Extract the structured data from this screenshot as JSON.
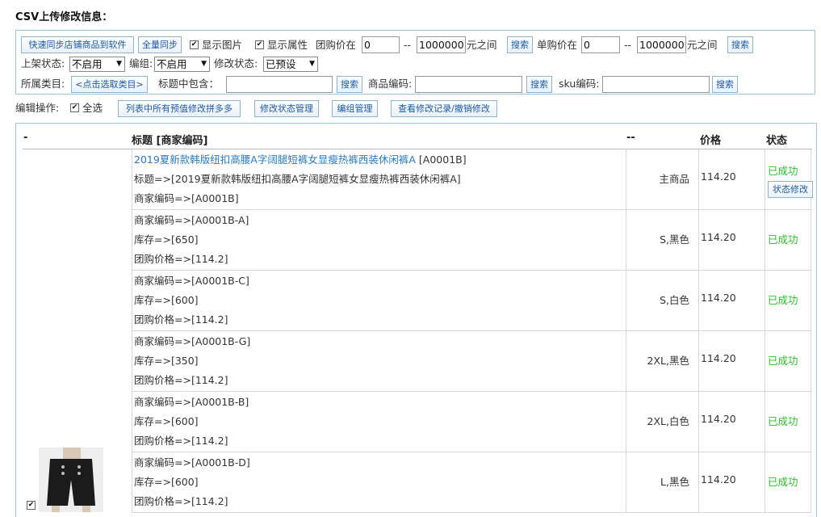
{
  "page": {
    "title": "CSV上传修改信息："
  },
  "filters": {
    "sync_button": "快速同步店铺商品到软件",
    "full_sync_button": "全量同步",
    "show_image_label": "显示图片",
    "show_attr_label": "显示属性",
    "group_price_label": "团购价在",
    "group_price_min": "0",
    "group_price_sep": "--",
    "group_price_max": "1000000",
    "group_price_unit": "元之间",
    "search_label": "搜索",
    "unit_price_label": "单购价在",
    "unit_price_min": "0",
    "unit_price_sep": "--",
    "unit_price_max": "1000000",
    "unit_price_unit": "元之间",
    "listing_status_label": "上架状态:",
    "listing_status_value": "不启用",
    "group_label": "编组:",
    "group_value": "不启用",
    "modify_status_label": "修改状态:",
    "modify_status_value": "已预设",
    "category_label": "所属类目:",
    "category_button": "<点击选取类目>",
    "title_contains_label": "标题中包含：",
    "product_code_label": "商品编码:",
    "sku_code_label": "sku编码:"
  },
  "edit_bar": {
    "label": "编辑操作:",
    "select_all": "全选",
    "apply_preset_button": "列表中所有预值修改拼多多",
    "status_manage_button": "修改状态管理",
    "group_manage_button": "编组管理",
    "history_button": "查看修改记录/撤销修改"
  },
  "table": {
    "headers": {
      "col0": "-",
      "title": "标题 [商家编码]",
      "spec": "--",
      "price": "价格",
      "status": "状态"
    },
    "main": {
      "title_link": "2019夏新款韩版纽扣高腰A字阔腿短裤女显瘦热裤西装休闲裤A",
      "code": "[A0001B]",
      "title_line": "标题=>[2019夏新款韩版纽扣高腰A字阔腿短裤女显瘦热裤西装休闲裤A]",
      "code_line": "商家编码=>[A0001B]",
      "spec": "主商品",
      "price": "114.20",
      "status": "已成功",
      "status_button": "状态修改"
    },
    "rows": [
      {
        "code_line": "商家编码=>[A0001B-A]",
        "stock_line": "库存=>[650]",
        "price_line": "团购价格=>[114.2]",
        "spec": "S,黑色",
        "price": "114.20",
        "status": "已成功"
      },
      {
        "code_line": "商家编码=>[A0001B-C]",
        "stock_line": "库存=>[600]",
        "price_line": "团购价格=>[114.2]",
        "spec": "S,白色",
        "price": "114.20",
        "status": "已成功"
      },
      {
        "code_line": "商家编码=>[A0001B-G]",
        "stock_line": "库存=>[350]",
        "price_line": "团购价格=>[114.2]",
        "spec": "2XL,黑色",
        "price": "114.20",
        "status": "已成功"
      },
      {
        "code_line": "商家编码=>[A0001B-B]",
        "stock_line": "库存=>[600]",
        "price_line": "团购价格=>[114.2]",
        "spec": "2XL,白色",
        "price": "114.20",
        "status": "已成功"
      },
      {
        "code_line": "商家编码=>[A0001B-D]",
        "stock_line": "库存=>[600]",
        "price_line": "团购价格=>[114.2]",
        "spec": "L,黑色",
        "price": "114.20",
        "status": "已成功"
      }
    ]
  },
  "colors": {
    "link": "#2a7bbf",
    "success": "#2bbf2b",
    "border": "#9cc4dd",
    "button_text": "#1a5aa6"
  }
}
